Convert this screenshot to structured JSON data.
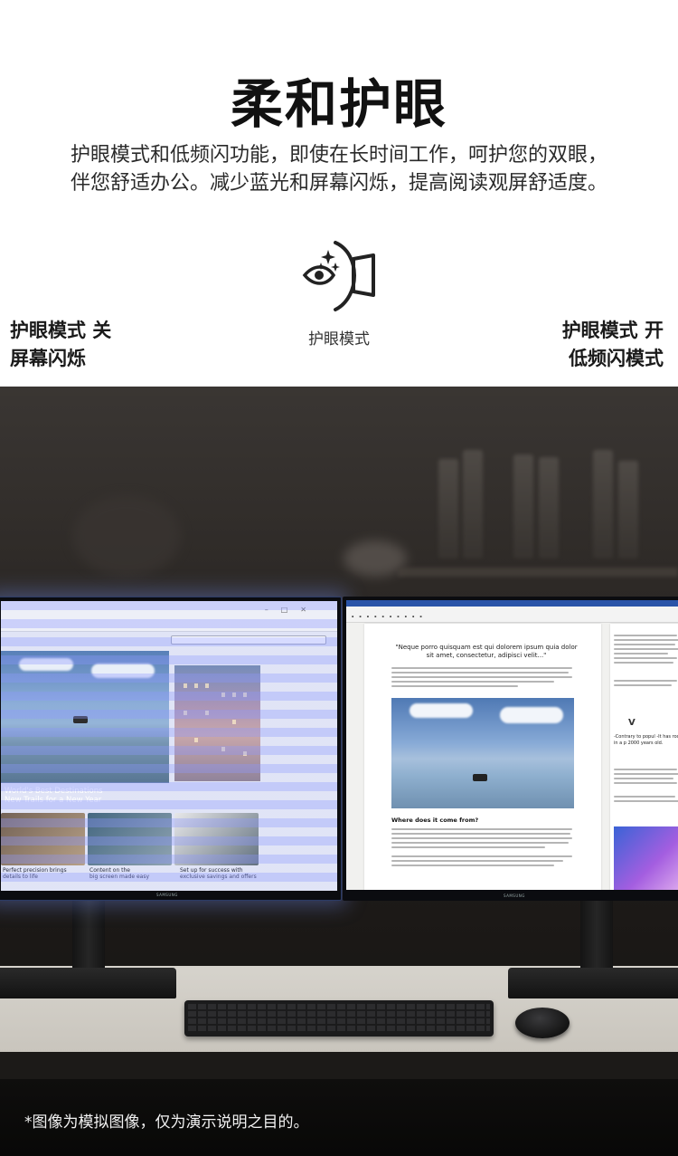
{
  "header": {
    "title": "柔和护眼",
    "description_lines": [
      "护眼模式和低频闪功能，即使在长时间工作，呵护您的双眼，",
      "伴您舒适办公。减少蓝光和屏幕闪烁，提高阅读观屏舒适度。"
    ]
  },
  "mode": {
    "icon": "eye-care-icon",
    "caption": "护眼模式"
  },
  "left_label": {
    "line1": "护眼模式 关",
    "line2": "屏幕闪烁"
  },
  "right_label": {
    "line1": "护眼模式 开",
    "line2": "低频闪模式"
  },
  "left_screen": {
    "hero_title_1": "World's Best Destinations",
    "hero_title_2": "New Trails for a New Year",
    "cards": [
      {
        "title_1": "Perfect precision brings",
        "title_2": "details to life"
      },
      {
        "title_1": "Content on the",
        "title_2": "big screen made easy"
      },
      {
        "title_1": "Set up for success with",
        "title_2": "exclusive savings and offers"
      }
    ],
    "brand": "SAMSUNG"
  },
  "right_screen": {
    "quote": "\"Neque porro quisquam est qui dolorem ipsum quia dolor sit amet, consectetur, adipisci velit...\"",
    "heading": "Where does it come from?",
    "side_letter": "V",
    "side_quote": "-Contrary to popul -It has roots in a p 2000 years old.",
    "brand": "SAMSUNG"
  },
  "footer": {
    "disclaimer": "*图像为模拟图像，仅为演示说明之目的。"
  },
  "colors": {
    "flicker_stripe": "#969fff",
    "scene_dark": "#1e1b19",
    "desk": "#d6d3cc"
  }
}
